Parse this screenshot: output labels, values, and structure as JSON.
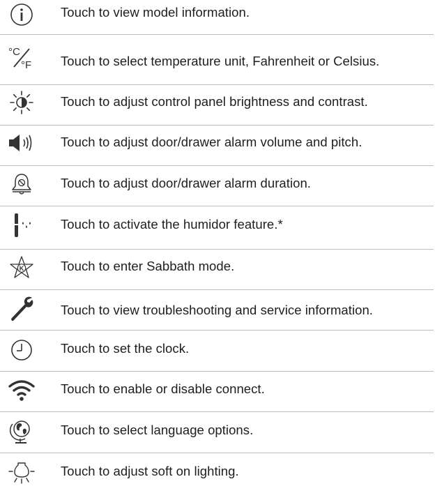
{
  "rows": [
    {
      "icon": "info-icon",
      "text": "Touch to view model information."
    },
    {
      "icon": "temperature-unit-icon",
      "text": "Touch to select temperature unit, Fahrenheit or Celsius.",
      "unit_c": "°C",
      "unit_f": "°F"
    },
    {
      "icon": "brightness-icon",
      "text": "Touch to adjust control panel brightness and contrast."
    },
    {
      "icon": "speaker-volume-icon",
      "text": "Touch to adjust door/drawer alarm volume and pitch."
    },
    {
      "icon": "alarm-bell-icon",
      "text": "Touch to adjust door/drawer alarm duration."
    },
    {
      "icon": "humidor-icon",
      "text": "Touch to activate the humidor feature.*"
    },
    {
      "icon": "sabbath-star-icon",
      "text": "Touch to enter Sabbath mode.",
      "star_letter": "K"
    },
    {
      "icon": "wrench-icon",
      "text": "Touch to view troubleshooting and service information."
    },
    {
      "icon": "clock-icon",
      "text": "Touch to set the clock."
    },
    {
      "icon": "wifi-icon",
      "text": "Touch to enable or disable connect."
    },
    {
      "icon": "globe-icon",
      "text": "Touch to select language options."
    },
    {
      "icon": "soft-light-icon",
      "text": "Touch to adjust soft on lighting."
    }
  ]
}
